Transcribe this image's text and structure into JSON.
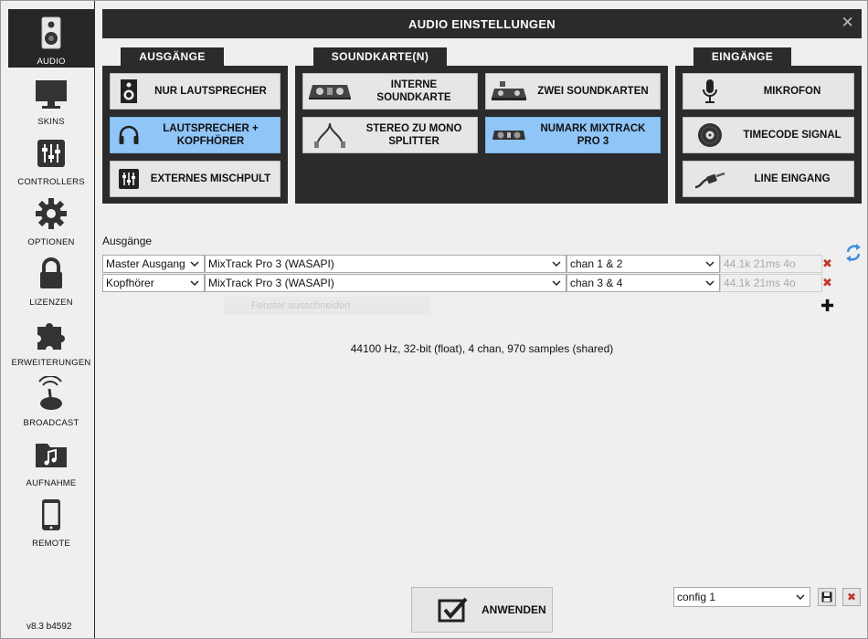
{
  "window": {
    "title": "AUDIO EINSTELLUNGEN"
  },
  "sidebar": {
    "items": [
      {
        "label": "AUDIO",
        "icon": "speaker-icon",
        "active": true
      },
      {
        "label": "SKINS",
        "icon": "monitor-icon"
      },
      {
        "label": "CONTROLLERS",
        "icon": "mixer-sliders-icon"
      },
      {
        "label": "OPTIONEN",
        "icon": "gear-icon"
      },
      {
        "label": "LIZENZEN",
        "icon": "lock-icon"
      },
      {
        "label": "ERWEITERUNGEN",
        "icon": "puzzle-icon"
      },
      {
        "label": "BROADCAST",
        "icon": "broadcast-icon"
      },
      {
        "label": "AUFNAHME",
        "icon": "music-folder-icon"
      },
      {
        "label": "REMOTE",
        "icon": "phone-icon"
      }
    ],
    "version": "v8.3 b4592"
  },
  "panels": {
    "outputs": {
      "title": "AUSGÄNGE",
      "buttons": [
        {
          "label": "NUR LAUTSPRECHER",
          "icon": "speaker-icon"
        },
        {
          "label": "LAUTSPRECHER + KOPFHÖRER",
          "icon": "headphones-icon",
          "selected": true
        },
        {
          "label": "EXTERNES MISCHPULT",
          "icon": "mixer-sliders-icon"
        }
      ]
    },
    "soundcards": {
      "title": "SOUNDKARTE(N)",
      "buttons": [
        {
          "label": "INTERNE SOUNDKARTE",
          "icon": "dj-controller-icon"
        },
        {
          "label": "ZWEI SOUNDKARTEN",
          "icon": "dual-soundcard-icon"
        },
        {
          "label": "STEREO ZU MONO SPLITTER",
          "icon": "splitter-cable-icon"
        },
        {
          "label": "NUMARK MIXTRACK PRO 3",
          "icon": "numark-controller-icon",
          "selected": true
        }
      ]
    },
    "inputs": {
      "title": "EINGÄNGE",
      "buttons": [
        {
          "label": "MIKROFON",
          "icon": "microphone-icon"
        },
        {
          "label": "TIMECODE SIGNAL",
          "icon": "vinyl-icon"
        },
        {
          "label": "LINE EINGANG",
          "icon": "line-cable-icon"
        }
      ]
    }
  },
  "outputs": {
    "label": "Ausgänge",
    "rows": [
      {
        "channel": "Master Ausgang",
        "device": "MixTrack Pro 3 (WASAPI)",
        "chan": "chan 1 & 2",
        "info": "44.1k 21ms 4o"
      },
      {
        "channel": "Kopfhörer",
        "device": "MixTrack Pro 3 (WASAPI)",
        "chan": "chan 3 & 4",
        "info": "44.1k 21ms 4o"
      }
    ],
    "ghost_tooltip": "Fenster ausschneiden",
    "status": "44100 Hz, 32-bit (float), 4 chan, 970 samples (shared)"
  },
  "footer": {
    "apply_label": "ANWENDEN",
    "config_value": "config 1"
  },
  "colors": {
    "dark": "#2b2b2b",
    "selected": "#8fc5f7",
    "button": "#e6e6e6",
    "delete": "#c0392b"
  }
}
